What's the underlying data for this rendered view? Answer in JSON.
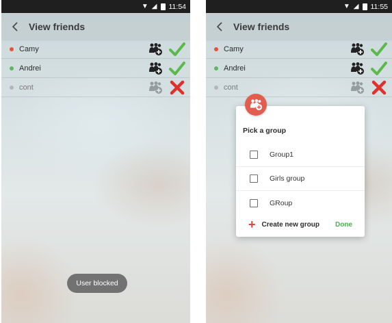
{
  "colors": {
    "online": "#e5533b",
    "active": "#5cb85c",
    "offline": "#b5b5b5",
    "accept": "#5ab94a",
    "reject": "#e0302c",
    "done": "#4caf50"
  },
  "left_screen": {
    "status_time": "11:54",
    "title": "View friends",
    "friends": [
      {
        "name": "Camy",
        "dot": "red",
        "add_icon": "group-add-icon",
        "action": "accept-check-icon"
      },
      {
        "name": "Andrei",
        "dot": "green",
        "add_icon": "group-add-icon",
        "action": "accept-check-icon"
      },
      {
        "name": "cont",
        "dot": "gray",
        "add_icon": "group-add-icon-disabled",
        "action": "reject-x-icon"
      }
    ],
    "toast": "User blocked"
  },
  "right_screen": {
    "status_time": "11:55",
    "title": "View friends",
    "friends": [
      {
        "name": "Camy",
        "dot": "red"
      },
      {
        "name": "Andrei",
        "dot": "green"
      },
      {
        "name": "cont",
        "dot": "gray"
      }
    ],
    "dialog": {
      "title": "Pick a group",
      "groups": [
        "Group1",
        "Girls group",
        "GRoup"
      ],
      "create_label": "Create new group",
      "done_label": "Done"
    }
  }
}
